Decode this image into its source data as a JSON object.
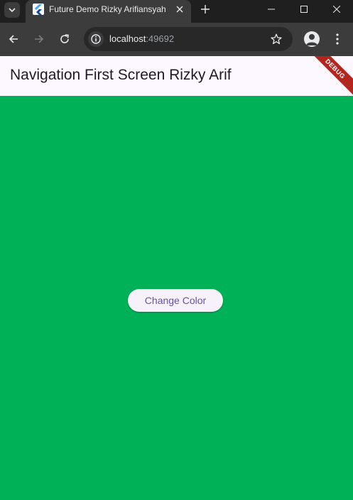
{
  "browser": {
    "tab_title": "Future Demo Rizky Arifiansyah",
    "url_host": "localhost",
    "url_port": ":49692"
  },
  "app": {
    "title": "Navigation First Screen Rizky Arif",
    "debug_banner": "DEBUG",
    "background_color": "#00b157",
    "appbar_color": "#fdf7ff",
    "button_label": "Change Color",
    "button_text_color": "#6750a4"
  },
  "icons": {
    "tab_search": "chevron-down-icon",
    "favicon": "flutter-icon",
    "tab_close": "close-icon",
    "new_tab": "plus-icon",
    "minimize": "minimize-icon",
    "maximize": "maximize-icon",
    "close_window": "close-icon",
    "back": "arrow-left-icon",
    "forward": "arrow-right-icon",
    "reload": "reload-icon",
    "site_info": "info-icon",
    "bookmark": "star-icon",
    "profile": "person-icon",
    "menu": "kebab-menu-icon"
  }
}
